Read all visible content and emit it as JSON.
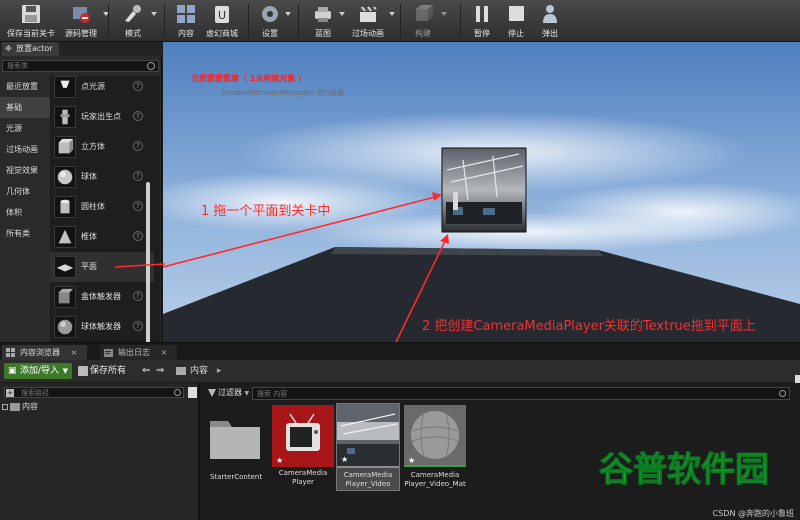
{
  "toolbar": {
    "items": [
      {
        "label": "保存当前关卡",
        "icon": "save-icon"
      },
      {
        "label": "源码管理",
        "icon": "source-control-icon"
      },
      {
        "label": "模式",
        "icon": "modes-icon"
      },
      {
        "label": "内容",
        "icon": "content-icon"
      },
      {
        "label": "虚幻商城",
        "icon": "marketplace-icon"
      },
      {
        "label": "设置",
        "icon": "settings-icon"
      },
      {
        "label": "蓝图",
        "icon": "blueprint-icon"
      },
      {
        "label": "过场动画",
        "icon": "cinematics-icon"
      },
      {
        "label": "构建",
        "icon": "build-icon"
      },
      {
        "label": "暂停",
        "icon": "pause-icon"
      },
      {
        "label": "停止",
        "icon": "stop-icon"
      },
      {
        "label": "弹出",
        "icon": "eject-icon"
      }
    ]
  },
  "place_panel": {
    "tab": "放置actor",
    "search_placeholder": "搜索类",
    "categories": [
      "最近放置",
      "基础",
      "光源",
      "过场动画",
      "视觉效果",
      "几何体",
      "体积",
      "所有类"
    ],
    "active_category": "基础",
    "items": [
      "点光源",
      "玩家出生点",
      "立方体",
      "球体",
      "圆柱体",
      "椎体",
      "平面",
      "盒体触发器",
      "球体触发器"
    ]
  },
  "viewport": {
    "warning": "光照需要重建（ 1未构建对象 ）",
    "sub_text": "DisableAllScreenMessages'进行隐藏"
  },
  "annotations": {
    "step1": "1 拖一个平面到关卡中",
    "step2": "2 把创建CameraMediaPlayer关联的Textrue拖到平面上"
  },
  "bottom_tabs": {
    "content_browser": "内容浏览器",
    "output_log": "输出日志"
  },
  "content_browser": {
    "add_import": "添加/导入",
    "save_all": "保存所有",
    "breadcrumb": "内容",
    "search_paths_placeholder": "搜索路径",
    "tree_root": "内容",
    "filters": "过滤器",
    "asset_search_placeholder": "搜索 内容",
    "assets": [
      {
        "label": "StarterContent",
        "type": "folder"
      },
      {
        "label": "CameraMedia Player",
        "type": "media-player",
        "accent": "#a8161a"
      },
      {
        "label": "CameraMedia Player_Video",
        "type": "media-texture",
        "accent": "#8c8c8c"
      },
      {
        "label": "CameraMedia Player_Video_Mat",
        "type": "material",
        "accent": "#3da13d"
      }
    ]
  },
  "watermark": {
    "text": "谷普软件园",
    "color": "#1fbf3a"
  },
  "footer": {
    "credit": "CSDN @奔跑的小鲁班"
  },
  "colors": {
    "annotation": "#ff2a2a",
    "add_button": "#3c7a2a",
    "sky_top": "#4f7fbf",
    "sky_bottom": "#a7c3e2"
  }
}
